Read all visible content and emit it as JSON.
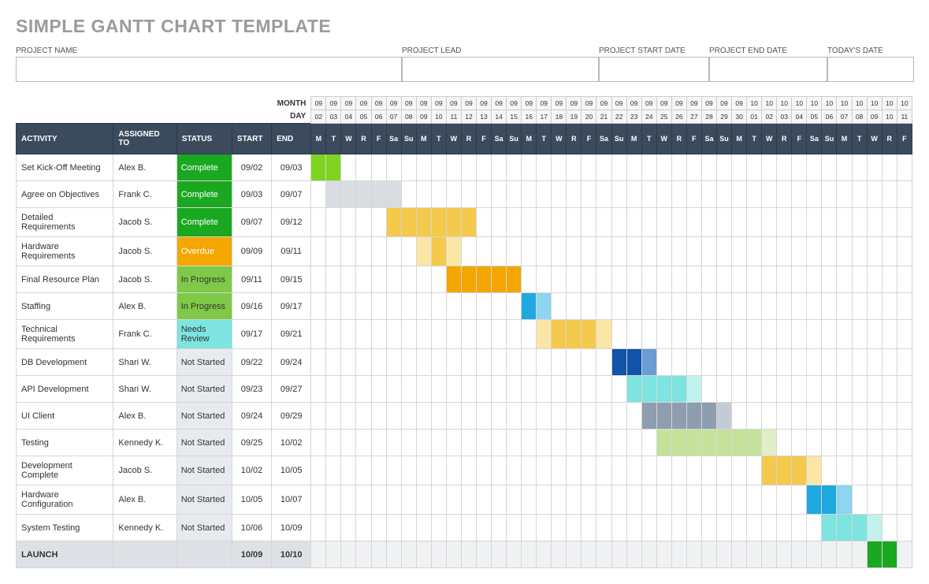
{
  "title": "SIMPLE GANTT CHART TEMPLATE",
  "meta_labels": {
    "project_name": "PROJECT NAME",
    "project_lead": "PROJECT LEAD",
    "start_date": "PROJECT START DATE",
    "end_date": "PROJECT END DATE",
    "today": "TODAY'S DATE"
  },
  "header_labels": {
    "month": "MONTH",
    "day": "DAY",
    "activity": "ACTIVITY",
    "assigned_to": "ASSIGNED TO",
    "status": "STATUS",
    "start": "START",
    "end": "END"
  },
  "status_colors": {
    "Complete": "#1aa821",
    "Overdue": "#f3a700",
    "In Progress": "#7fc948",
    "Needs Review": "#7de4df",
    "Not Started": "#e7ebef"
  },
  "calendar": [
    {
      "m": "09",
      "d": "02",
      "w": "M"
    },
    {
      "m": "09",
      "d": "03",
      "w": "T"
    },
    {
      "m": "09",
      "d": "04",
      "w": "W"
    },
    {
      "m": "09",
      "d": "05",
      "w": "R"
    },
    {
      "m": "09",
      "d": "06",
      "w": "F"
    },
    {
      "m": "09",
      "d": "07",
      "w": "Sa"
    },
    {
      "m": "09",
      "d": "08",
      "w": "Su"
    },
    {
      "m": "09",
      "d": "09",
      "w": "M"
    },
    {
      "m": "09",
      "d": "10",
      "w": "T"
    },
    {
      "m": "09",
      "d": "11",
      "w": "W"
    },
    {
      "m": "09",
      "d": "12",
      "w": "R"
    },
    {
      "m": "09",
      "d": "13",
      "w": "F"
    },
    {
      "m": "09",
      "d": "14",
      "w": "Sa"
    },
    {
      "m": "09",
      "d": "15",
      "w": "Su"
    },
    {
      "m": "09",
      "d": "16",
      "w": "M"
    },
    {
      "m": "09",
      "d": "17",
      "w": "T"
    },
    {
      "m": "09",
      "d": "18",
      "w": "W"
    },
    {
      "m": "09",
      "d": "19",
      "w": "R"
    },
    {
      "m": "09",
      "d": "20",
      "w": "F"
    },
    {
      "m": "09",
      "d": "21",
      "w": "Sa"
    },
    {
      "m": "09",
      "d": "22",
      "w": "Su"
    },
    {
      "m": "09",
      "d": "23",
      "w": "M"
    },
    {
      "m": "09",
      "d": "24",
      "w": "T"
    },
    {
      "m": "09",
      "d": "25",
      "w": "W"
    },
    {
      "m": "09",
      "d": "26",
      "w": "R"
    },
    {
      "m": "09",
      "d": "27",
      "w": "F"
    },
    {
      "m": "09",
      "d": "28",
      "w": "Sa"
    },
    {
      "m": "09",
      "d": "29",
      "w": "Su"
    },
    {
      "m": "09",
      "d": "30",
      "w": "M"
    },
    {
      "m": "10",
      "d": "01",
      "w": "T"
    },
    {
      "m": "10",
      "d": "02",
      "w": "W"
    },
    {
      "m": "10",
      "d": "03",
      "w": "R"
    },
    {
      "m": "10",
      "d": "04",
      "w": "F"
    },
    {
      "m": "10",
      "d": "05",
      "w": "Sa"
    },
    {
      "m": "10",
      "d": "06",
      "w": "Su"
    },
    {
      "m": "10",
      "d": "07",
      "w": "M"
    },
    {
      "m": "10",
      "d": "08",
      "w": "T"
    },
    {
      "m": "10",
      "d": "09",
      "w": "W"
    },
    {
      "m": "10",
      "d": "10",
      "w": "R"
    },
    {
      "m": "10",
      "d": "11",
      "w": "F"
    }
  ],
  "rows": [
    {
      "activity": "Set Kick-Off Meeting",
      "assigned": "Alex B.",
      "status": "Complete",
      "start": "09/02",
      "end": "09/03",
      "bar_start": 0,
      "bar_len": 2,
      "bar_color": "#7ed321",
      "bar_fade": ""
    },
    {
      "activity": "Agree on Objectives",
      "assigned": "Frank C.",
      "status": "Complete",
      "start": "09/03",
      "end": "09/07",
      "bar_start": 1,
      "bar_len": 5,
      "bar_color": "#d9dde2",
      "bar_fade": ""
    },
    {
      "activity": "Detailed Requirements",
      "assigned": "Jacob S.",
      "status": "Complete",
      "start": "09/07",
      "end": "09/12",
      "bar_start": 5,
      "bar_len": 6,
      "bar_color": "#f5c94b",
      "bar_fade": ""
    },
    {
      "activity": "Hardware Requirements",
      "assigned": "Jacob S.",
      "status": "Overdue",
      "start": "09/09",
      "end": "09/11",
      "bar_start": 7,
      "bar_len": 3,
      "bar_color": "#f5c94b",
      "bar_fade": "#fbe6a6"
    },
    {
      "activity": "Final Resource Plan",
      "assigned": "Jacob S.",
      "status": "In Progress",
      "start": "09/11",
      "end": "09/15",
      "bar_start": 9,
      "bar_len": 5,
      "bar_color": "#f3a700",
      "bar_fade": ""
    },
    {
      "activity": "Staffing",
      "assigned": "Alex B.",
      "status": "In Progress",
      "start": "09/16",
      "end": "09/17",
      "bar_start": 14,
      "bar_len": 2,
      "bar_color": "#1fa9e0",
      "bar_fade": "#8dd5f0"
    },
    {
      "activity": "Technical Requirements",
      "assigned": "Frank C.",
      "status": "Needs Review",
      "start": "09/17",
      "end": "09/21",
      "bar_start": 15,
      "bar_len": 5,
      "bar_color": "#f5c94b",
      "bar_fade": "#fbe6a6"
    },
    {
      "activity": "DB Development",
      "assigned": "Shari W.",
      "status": "Not Started",
      "start": "09/22",
      "end": "09/24",
      "bar_start": 20,
      "bar_len": 3,
      "bar_color": "#1053a8",
      "bar_fade": "#6a9bd2"
    },
    {
      "activity": "API Development",
      "assigned": "Shari W.",
      "status": "Not Started",
      "start": "09/23",
      "end": "09/27",
      "bar_start": 21,
      "bar_len": 5,
      "bar_color": "#7de4df",
      "bar_fade": "#c2f1ee"
    },
    {
      "activity": "UI Client",
      "assigned": "Alex B.",
      "status": "Not Started",
      "start": "09/24",
      "end": "09/29",
      "bar_start": 22,
      "bar_len": 6,
      "bar_color": "#8e9db0",
      "bar_fade": "#c3cbd6"
    },
    {
      "activity": "Testing",
      "assigned": "Kennedy K.",
      "status": "Not Started",
      "start": "09/25",
      "end": "10/02",
      "bar_start": 23,
      "bar_len": 8,
      "bar_color": "#c5e29b",
      "bar_fade": "#e1efc8"
    },
    {
      "activity": "Development Complete",
      "assigned": "Jacob S.",
      "status": "Not Started",
      "start": "10/02",
      "end": "10/05",
      "bar_start": 30,
      "bar_len": 4,
      "bar_color": "#f5c94b",
      "bar_fade": "#fbe6a6"
    },
    {
      "activity": "Hardware Configuration",
      "assigned": "Alex B.",
      "status": "Not Started",
      "start": "10/05",
      "end": "10/07",
      "bar_start": 33,
      "bar_len": 3,
      "bar_color": "#1fa9e0",
      "bar_fade": "#8dd5f0"
    },
    {
      "activity": "System Testing",
      "assigned": "Kennedy K.",
      "status": "Not Started",
      "start": "10/06",
      "end": "10/09",
      "bar_start": 34,
      "bar_len": 4,
      "bar_color": "#7de4df",
      "bar_fade": "#c2f1ee"
    },
    {
      "activity": "LAUNCH",
      "assigned": "",
      "status": "",
      "start": "10/09",
      "end": "10/10",
      "bar_start": 37,
      "bar_len": 2,
      "bar_color": "#1aa821",
      "bar_fade": "",
      "launch": true
    }
  ],
  "chart_data": {
    "type": "gantt",
    "title": "Simple Gantt Chart Template",
    "date_range": {
      "start": "09/02",
      "end": "10/11"
    },
    "tasks": [
      {
        "name": "Set Kick-Off Meeting",
        "assignee": "Alex B.",
        "status": "Complete",
        "start": "09/02",
        "end": "09/03"
      },
      {
        "name": "Agree on Objectives",
        "assignee": "Frank C.",
        "status": "Complete",
        "start": "09/03",
        "end": "09/07"
      },
      {
        "name": "Detailed Requirements",
        "assignee": "Jacob S.",
        "status": "Complete",
        "start": "09/07",
        "end": "09/12"
      },
      {
        "name": "Hardware Requirements",
        "assignee": "Jacob S.",
        "status": "Overdue",
        "start": "09/09",
        "end": "09/11"
      },
      {
        "name": "Final Resource Plan",
        "assignee": "Jacob S.",
        "status": "In Progress",
        "start": "09/11",
        "end": "09/15"
      },
      {
        "name": "Staffing",
        "assignee": "Alex B.",
        "status": "In Progress",
        "start": "09/16",
        "end": "09/17"
      },
      {
        "name": "Technical Requirements",
        "assignee": "Frank C.",
        "status": "Needs Review",
        "start": "09/17",
        "end": "09/21"
      },
      {
        "name": "DB Development",
        "assignee": "Shari W.",
        "status": "Not Started",
        "start": "09/22",
        "end": "09/24"
      },
      {
        "name": "API Development",
        "assignee": "Shari W.",
        "status": "Not Started",
        "start": "09/23",
        "end": "09/27"
      },
      {
        "name": "UI Client",
        "assignee": "Alex B.",
        "status": "Not Started",
        "start": "09/24",
        "end": "09/29"
      },
      {
        "name": "Testing",
        "assignee": "Kennedy K.",
        "status": "Not Started",
        "start": "09/25",
        "end": "10/02"
      },
      {
        "name": "Development Complete",
        "assignee": "Jacob S.",
        "status": "Not Started",
        "start": "10/02",
        "end": "10/05"
      },
      {
        "name": "Hardware Configuration",
        "assignee": "Alex B.",
        "status": "Not Started",
        "start": "10/05",
        "end": "10/07"
      },
      {
        "name": "System Testing",
        "assignee": "Kennedy K.",
        "status": "Not Started",
        "start": "10/06",
        "end": "10/09"
      },
      {
        "name": "LAUNCH",
        "assignee": "",
        "status": "",
        "start": "10/09",
        "end": "10/10"
      }
    ]
  }
}
